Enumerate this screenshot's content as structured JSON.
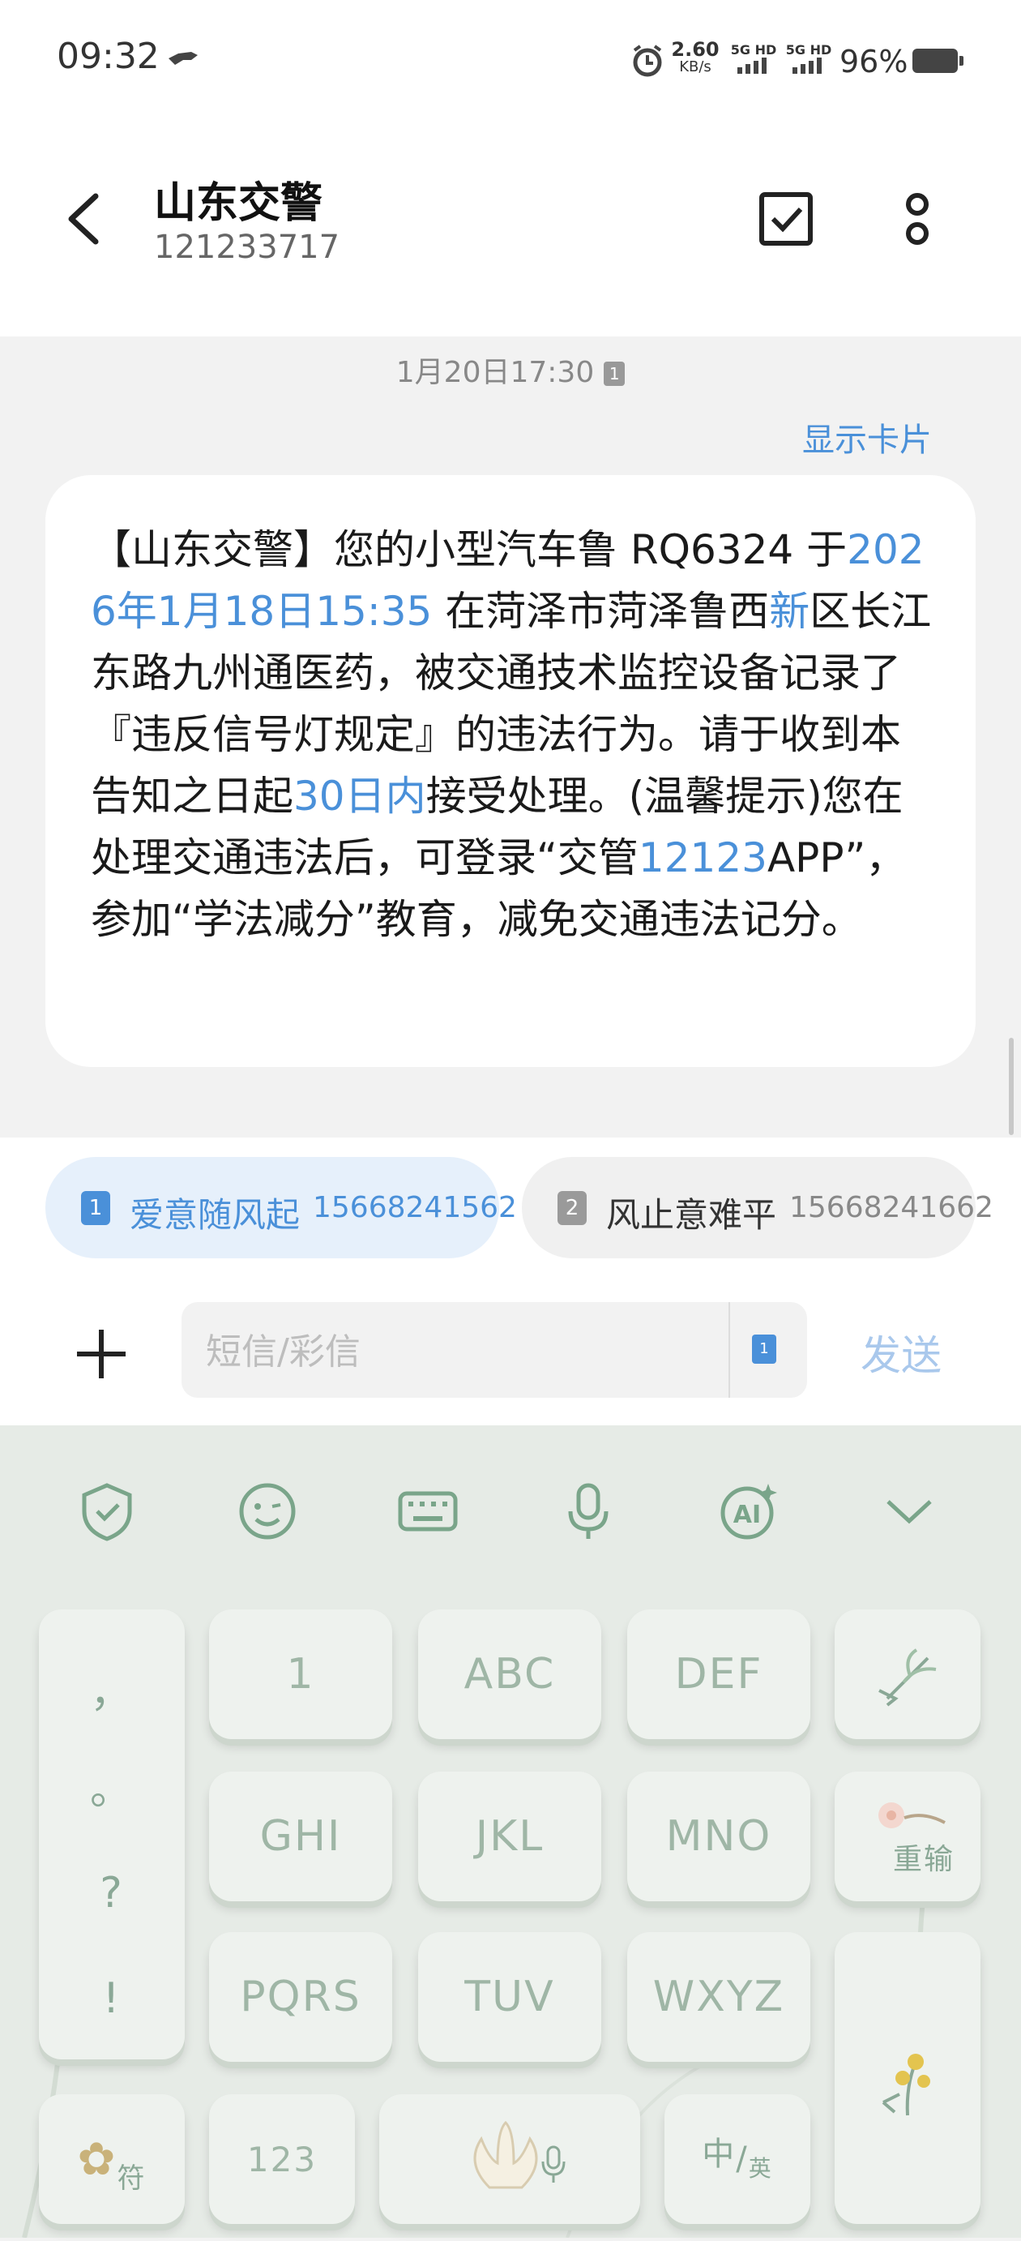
{
  "status_bar": {
    "time": "09:32",
    "speed": "2.60",
    "speed_unit": "KB/s",
    "net1": "5G HD",
    "net2": "5G HD",
    "battery": "96%"
  },
  "header": {
    "title": "山东交警",
    "subtitle": "121233717"
  },
  "conversation": {
    "datetime": "1月20日17:30",
    "sim_badge": "1",
    "show_card": "显示卡片",
    "message": {
      "p1": "【山东交警】您的小型汽车鲁 RQ6324 于",
      "l1": "2026年1月18日15:35",
      "p2": " 在菏泽市菏泽鲁西",
      "l2": "新",
      "p3": "区长江东路九州通医药，被交通技术监控设备记录了『违反信号灯规定』的违法行为。请于收到本告知之日起",
      "l3": "30日内",
      "p4": "接受处理。(温馨提示)您在处理交通违法后，可登录“交管",
      "l4": "12123",
      "p5": "APP”，参加“学法减分”教育，减免交通违法记分。"
    }
  },
  "sim_cards": [
    {
      "num": "1",
      "name": "爱意随风起",
      "phone": "15668241562"
    },
    {
      "num": "2",
      "name": "风止意难平",
      "phone": "15668241662"
    }
  ],
  "composer": {
    "placeholder": "短信/彩信",
    "sim": "1",
    "send_label": "发送"
  },
  "keyboard": {
    "punct": [
      "，",
      "。",
      "?",
      "!"
    ],
    "keys": {
      "k1": "1",
      "abc": "ABC",
      "def": "DEF",
      "ghi": "GHI",
      "jkl": "JKL",
      "mno": "MNO",
      "pqrs": "PQRS",
      "tuv": "TUV",
      "wxyz": "WXYZ"
    },
    "retype": "重输",
    "symbol": "符",
    "num": "123",
    "lang_a": "中",
    "lang_b": "英"
  }
}
